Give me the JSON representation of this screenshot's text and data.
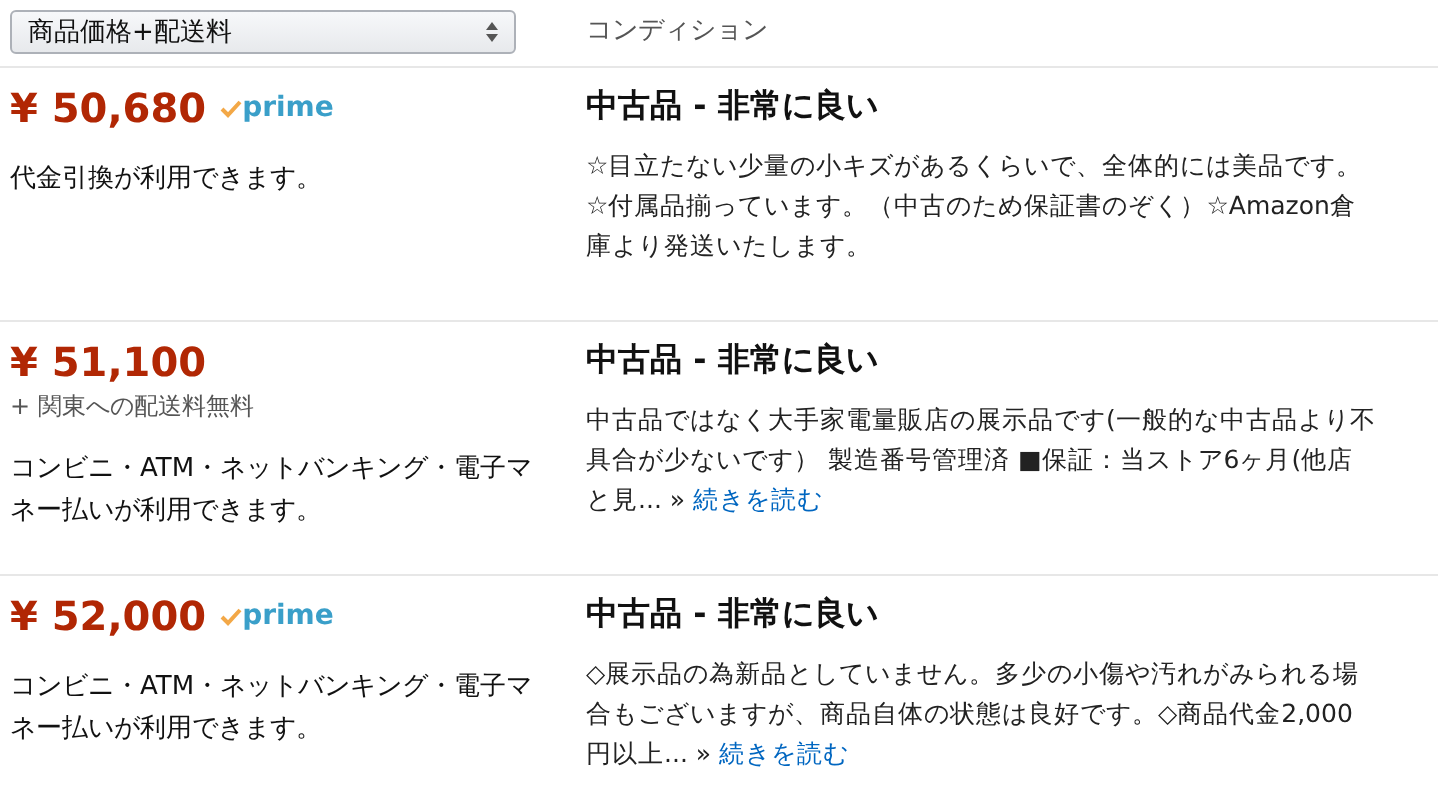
{
  "header": {
    "sort_select": {
      "value": "商品価格+配送料"
    },
    "condition_heading": "コンディション"
  },
  "offers": [
    {
      "price": "¥ 50,680",
      "prime_badge": "prime",
      "payment_note": "代金引換が利用できます。",
      "condition": "中古品 - 非常に良い",
      "description": "☆目立たない少量の小キズがあるくらいで、全体的には美品です。☆付属品揃っています。（中古のため保証書のぞく）☆Amazon倉庫より発送いたします。"
    },
    {
      "price": "¥ 51,100",
      "shipping_note": "+ 関東への配送料無料",
      "payment_note": "コンビニ・ATM・ネットバンキング・電子マネー払いが利用できます。",
      "condition": "中古品 - 非常に良い",
      "description": "中古品ではなく大手家電量販店の展示品です(一般的な中古品より不具合が少ないです） 製造番号管理済 ■保証：当ストア6ヶ月(他店と見...",
      "more_marker": "»",
      "more_link": "続きを読む"
    },
    {
      "price": "¥ 52,000",
      "prime_badge": "prime",
      "payment_note": "コンビニ・ATM・ネットバンキング・電子マネー払いが利用できます。",
      "condition": "中古品 - 非常に良い",
      "description": "◇展示品の為新品としていません。多少の小傷や汚れがみられる場合もございますが、商品自体の状態は良好です。◇商品代金2,000円以上...",
      "more_marker": "»",
      "more_link": "続きを読む"
    }
  ]
}
